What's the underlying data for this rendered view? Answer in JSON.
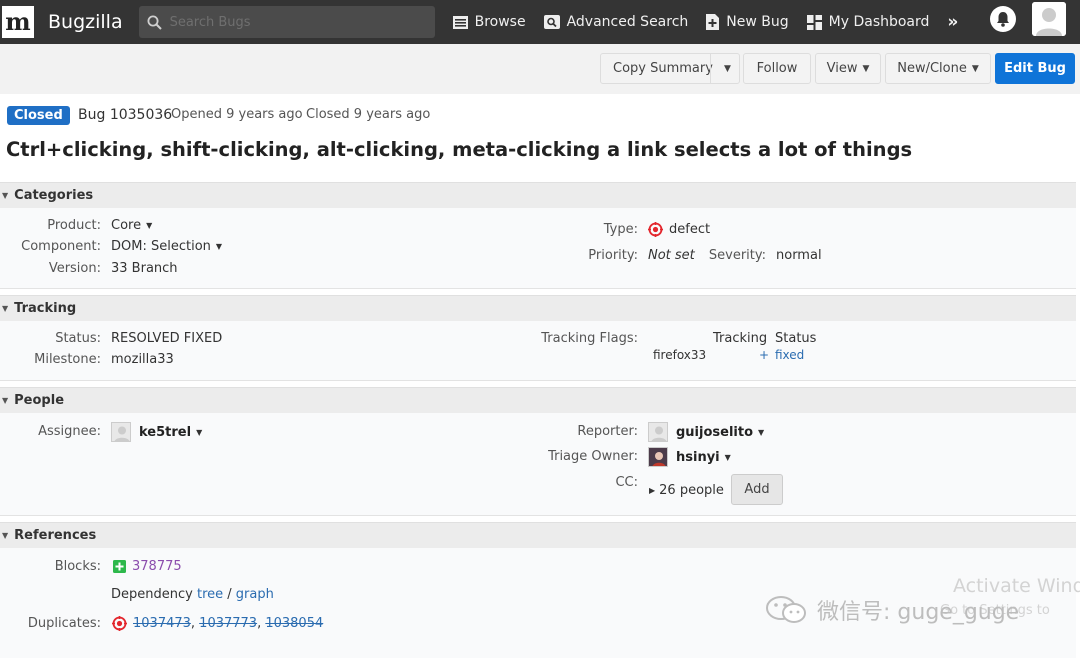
{
  "nav": {
    "logo_letter": "m",
    "app_name": "Bugzilla",
    "search_placeholder": "Search Bugs",
    "items": [
      {
        "label": "Browse",
        "icon": "browse-icon"
      },
      {
        "label": "Advanced Search",
        "icon": "advanced-search-icon"
      },
      {
        "label": "New Bug",
        "icon": "new-bug-icon"
      },
      {
        "label": "My Dashboard",
        "icon": "dashboard-icon"
      }
    ],
    "more": "»"
  },
  "toolbar": {
    "copy_summary": "Copy Summary",
    "follow": "Follow",
    "view": "View",
    "new_clone": "New/Clone",
    "edit_bug": "Edit Bug"
  },
  "header": {
    "status_badge": "Closed",
    "bug_id": "Bug 1035036",
    "opened": "Opened 9 years ago",
    "closed": "Closed 9 years ago",
    "summary": "Ctrl+clicking, shift-clicking, alt-clicking, meta-clicking a link selects a lot of things"
  },
  "categories": {
    "title": "Categories",
    "product_label": "Product:",
    "product": "Core",
    "component_label": "Component:",
    "component": "DOM: Selection",
    "version_label": "Version:",
    "version": "33 Branch",
    "type_label": "Type:",
    "type": "defect",
    "priority_label": "Priority:",
    "priority": "Not set",
    "severity_label": "Severity:",
    "severity": "normal"
  },
  "tracking": {
    "title": "Tracking",
    "status_label": "Status:",
    "status": "RESOLVED FIXED",
    "milestone_label": "Milestone:",
    "milestone": "mozilla33",
    "flags_label": "Tracking Flags:",
    "col_tracking": "Tracking",
    "col_status": "Status",
    "flag_name": "firefox33",
    "flag_tracking": "+",
    "flag_status": "fixed"
  },
  "people": {
    "title": "People",
    "assignee_label": "Assignee:",
    "assignee": "ke5trel",
    "reporter_label": "Reporter:",
    "reporter": "guijoselito",
    "triage_label": "Triage Owner:",
    "triage_owner": "hsinyi",
    "cc_label": "CC:",
    "cc_count": "26 people",
    "add_label": "Add"
  },
  "references": {
    "title": "References",
    "blocks_label": "Blocks:",
    "blocks": "378775",
    "dependency_text": "Dependency",
    "tree": "tree",
    "separator": "/",
    "graph": "graph",
    "duplicates_label": "Duplicates:",
    "duplicates": [
      "1037473",
      "1037773",
      "1038054"
    ]
  },
  "watermark": {
    "activate": "Activate Wind",
    "activate_sub": "Go to Settings to",
    "wechat": "微信号: guge_guge"
  },
  "colors": {
    "nav_bg": "#343434",
    "primary": "#0f74d8",
    "badge": "#1f6fc5",
    "defect_red": "#e3262d",
    "blocks_green": "#2db84b"
  }
}
